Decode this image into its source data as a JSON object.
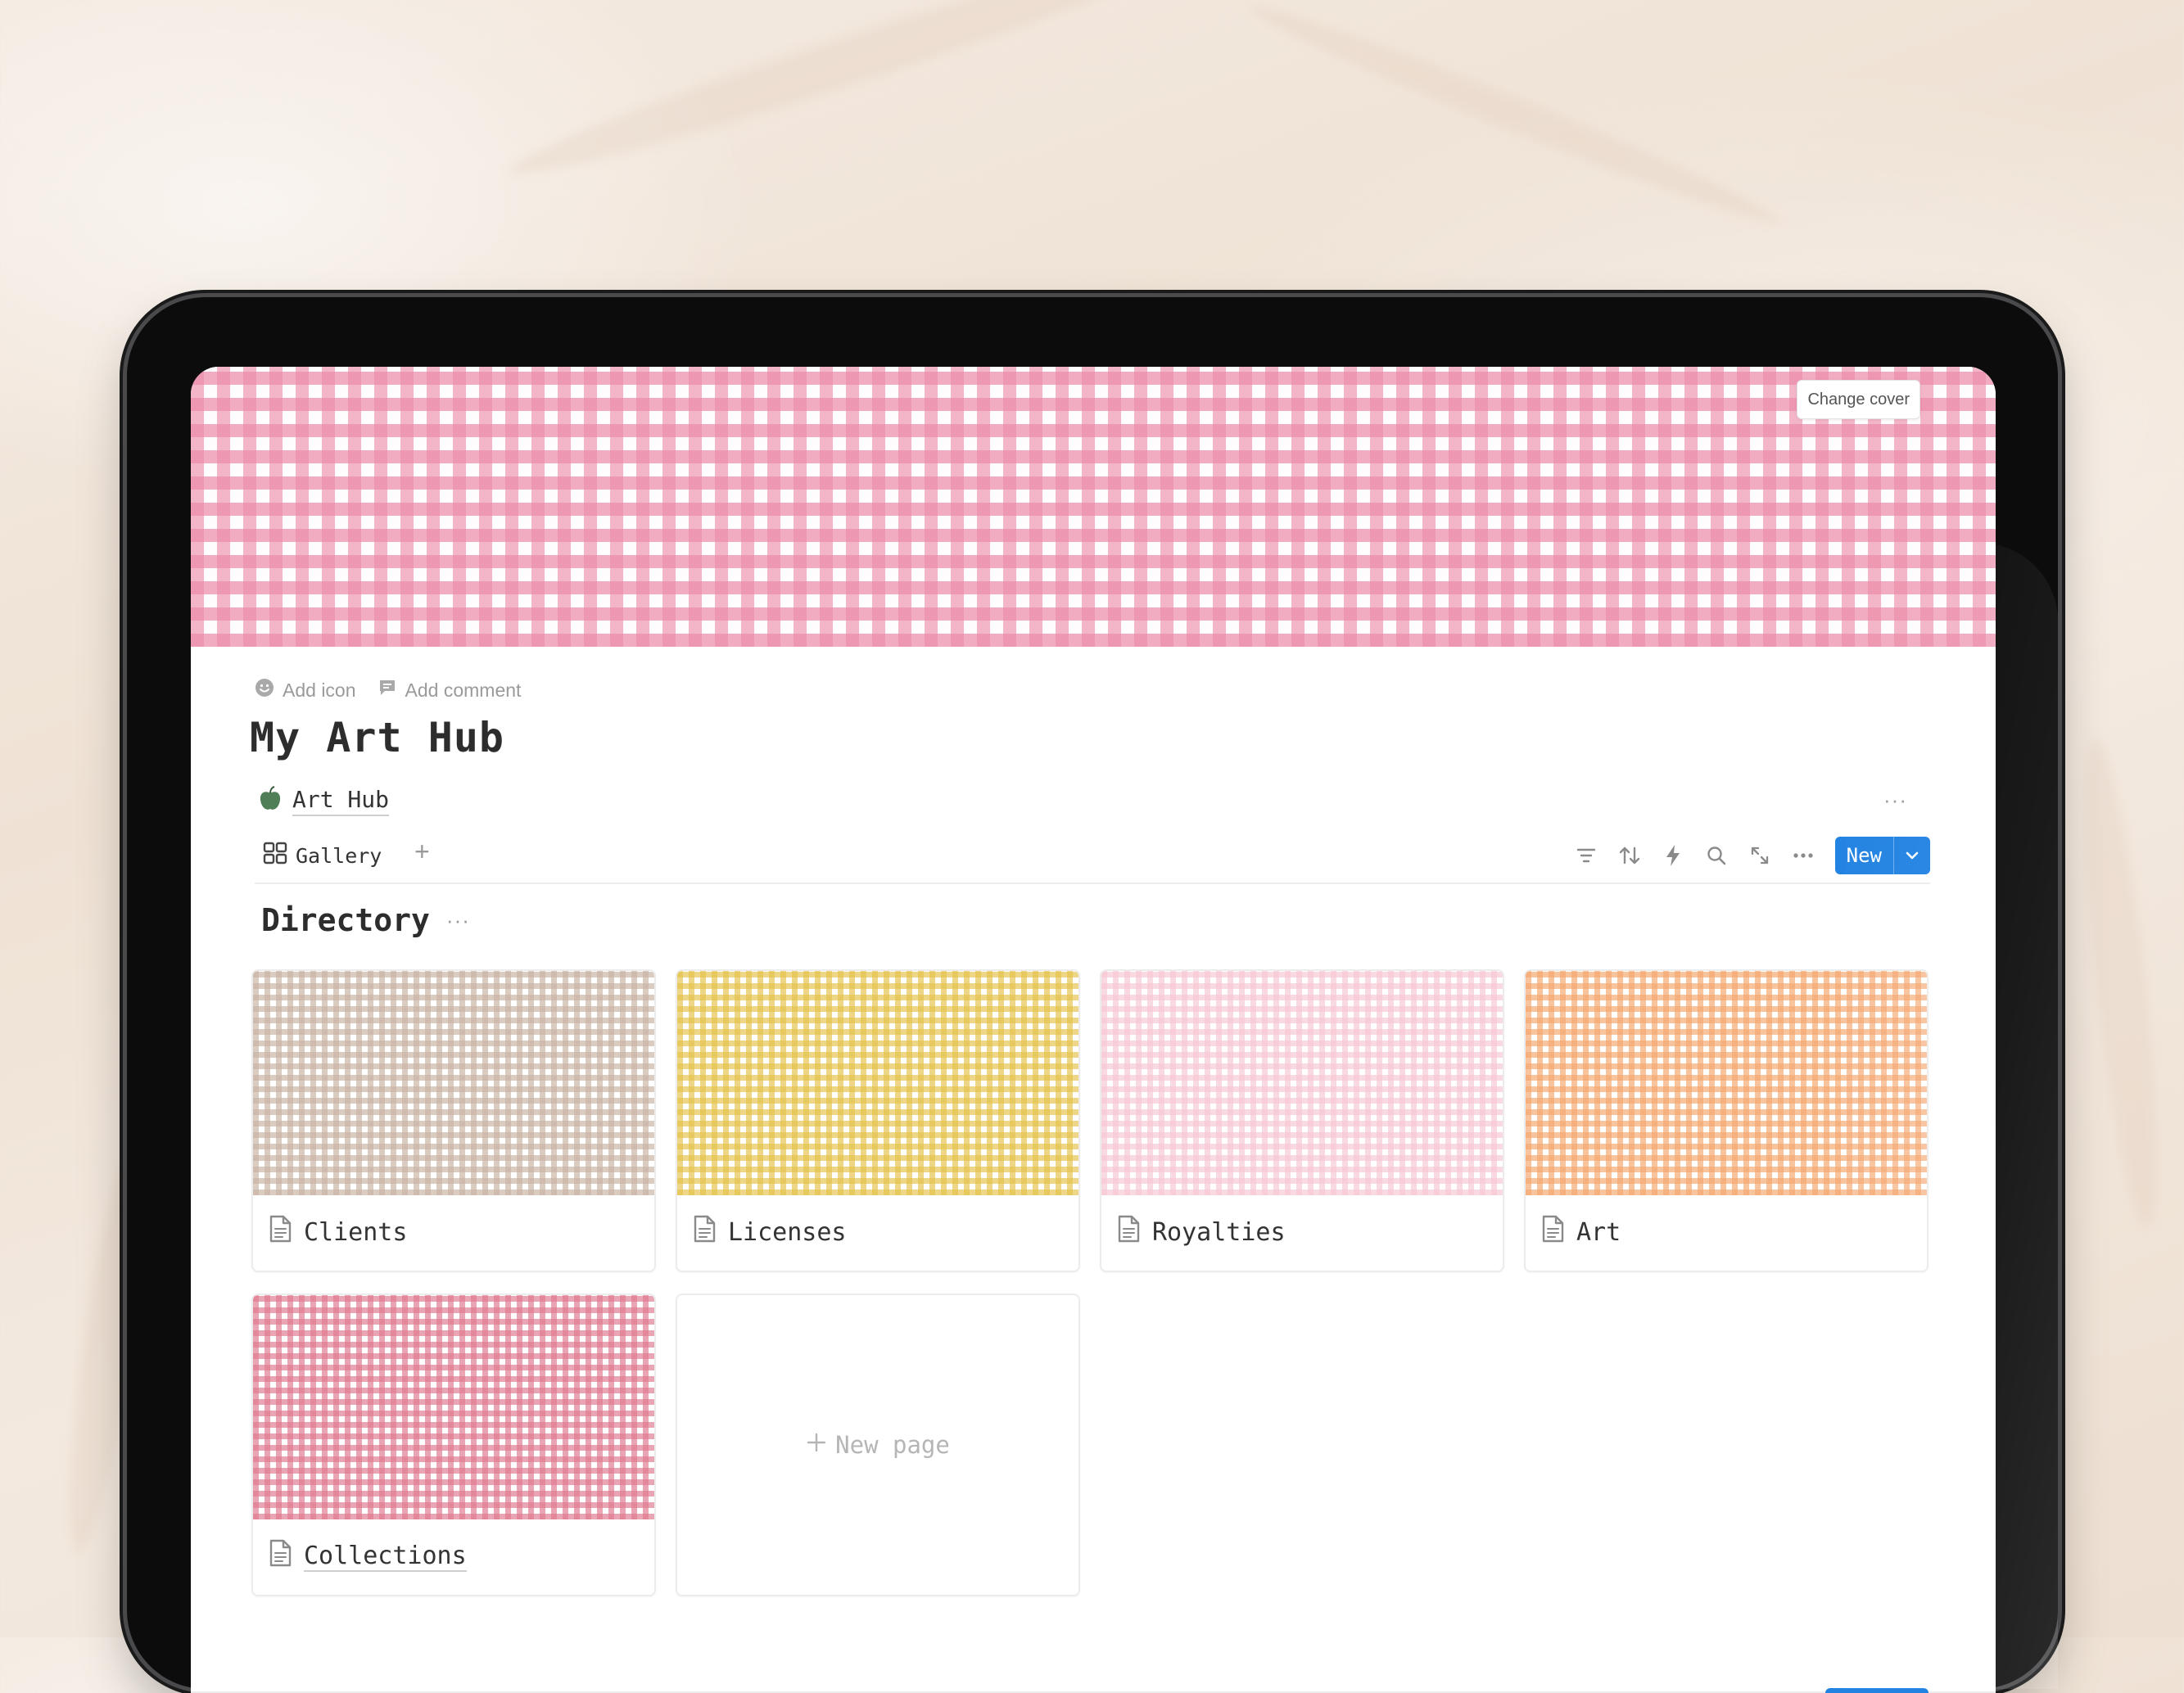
{
  "cover": {
    "change_cover_label": "Change cover"
  },
  "page_actions": {
    "add_icon_label": "Add icon",
    "add_comment_label": "Add comment"
  },
  "page": {
    "title": "My Art Hub"
  },
  "database": {
    "link_label": "Art Hub",
    "link_icon": "apple-icon",
    "more_label": "···",
    "view_tab_label": "Gallery",
    "add_view_label": "+",
    "new_button_label": "New"
  },
  "section": {
    "title": "Directory",
    "more_label": "···"
  },
  "cards": [
    {
      "name": "Clients",
      "color": "#c9b3a3"
    },
    {
      "name": "Licenses",
      "color": "#e4c24a"
    },
    {
      "name": "Royalties",
      "color": "#f7c7d3"
    },
    {
      "name": "Art",
      "color": "#f5a66e"
    },
    {
      "name": "Collections",
      "color": "#e0788f"
    }
  ],
  "new_page": {
    "label": "New page"
  },
  "colors": {
    "accent": "#2383e2",
    "cover_pink": "#ec8aa8"
  }
}
